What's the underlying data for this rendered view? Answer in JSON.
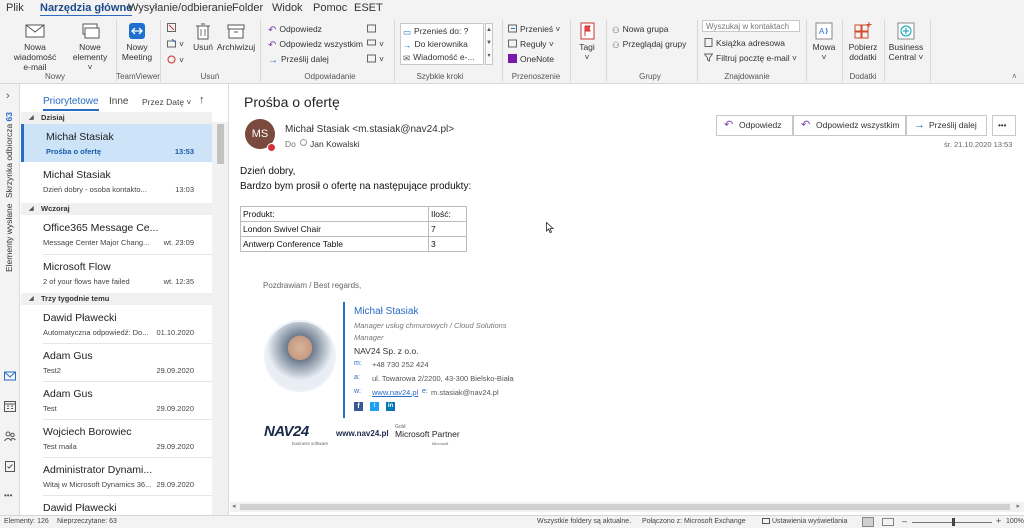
{
  "menu": {
    "tabs": [
      "Plik",
      "Narzędzia główne",
      "Wysyłanie/odbieranie",
      "Folder",
      "Widok",
      "Pomoc",
      "ESET"
    ],
    "active_index": 1
  },
  "ribbon": {
    "new_email": [
      "Nowa wiadomość",
      "e-mail"
    ],
    "new_items": [
      "Nowe",
      "elementy ˅"
    ],
    "group_new": "Nowy",
    "new_meeting": [
      "Nowy",
      "Meeting"
    ],
    "group_teamviewer": "TeamViewer",
    "delete": "Usuń",
    "archive": "Archiwizuj",
    "group_delete": "Usuń",
    "reply": "Odpowiedz",
    "reply_all": "Odpowiedz wszystkim",
    "forward": "Prześlij dalej",
    "group_respond": "Odpowiadanie",
    "qs_items": [
      "Przenieś do: ?",
      "Do kierownika",
      "Wiadomość e-..."
    ],
    "group_quicksteps": "Szybkie kroki",
    "move": "Przenieś ˅",
    "rules": "Reguły ˅",
    "onenote": "OneNote",
    "group_move": "Przenoszenie",
    "tags": [
      "Tagi",
      "˅"
    ],
    "new_group": "Nowa grupa",
    "browse_groups": "Przeglądaj grupy",
    "group_groups": "Grupy",
    "search_placeholder": "Wyszukaj w kontaktach",
    "address_book": "Książka adresowa",
    "filter_email": "Filtruj pocztę e-mail ˅",
    "group_find": "Znajdowanie",
    "speech": [
      "Mowa",
      "˅"
    ],
    "get_addins": [
      "Pobierz",
      "dodatki"
    ],
    "group_addins": "Dodatki",
    "business_central": [
      "Business",
      "Central ˅"
    ]
  },
  "leftnav": {
    "inbox_label": "Skrzynka odbiorcza",
    "inbox_count": "63",
    "sent_label": "Elementy wysłane",
    "expand_glyph": "›",
    "more_glyph": "•••"
  },
  "list": {
    "tab_focused": "Priorytetowe",
    "tab_other": "Inne",
    "sort": "Przez Datę ˅",
    "sort_dir": "↑",
    "groups": [
      "Dzisiaj",
      "Wczoraj",
      "Trzy tygodnie temu"
    ],
    "items": [
      {
        "sender": "Michał Stasiak",
        "subject": "Prośba o ofertę",
        "date": "13:53"
      },
      {
        "sender": "Michał Stasiak",
        "subject": "Dzień dobry - osoba kontakto...",
        "date": "13:03"
      },
      {
        "sender": "Office365 Message Ce...",
        "subject": "Message Center Major Chang...",
        "date": "wt. 23:09"
      },
      {
        "sender": "Microsoft Flow",
        "subject": "2 of your flows have failed",
        "date": "wt. 12:35"
      },
      {
        "sender": "Dawid Pławecki",
        "subject": "Automatyczna odpowiedź: Do...",
        "date": "01.10.2020"
      },
      {
        "sender": "Adam Gus",
        "subject": "Test2",
        "date": "29.09.2020"
      },
      {
        "sender": "Adam Gus",
        "subject": "Test",
        "date": "29.09.2020"
      },
      {
        "sender": "Wojciech Borowiec",
        "subject": "Test maila",
        "date": "29.09.2020"
      },
      {
        "sender": "Administrator Dynami...",
        "subject": "Witaj w Microsoft Dynamics 36...",
        "date": "29.09.2020"
      },
      {
        "sender": "Dawid Pławecki",
        "subject": "",
        "date": ""
      }
    ]
  },
  "mail": {
    "subject": "Prośba o ofertę",
    "initials": "MS",
    "from": "Michał Stasiak <m.stasiak@nav24.pl>",
    "to_label": "Do",
    "to": "Jan Kowalski",
    "btn_reply": "Odpowiedz",
    "btn_reply_all": "Odpowiedz wszystkim",
    "btn_forward": "Prześlij dalej",
    "btn_more": "•••",
    "date": "śr. 21.10.2020 13:53",
    "greeting": "Dzień dobry,",
    "body": "Bardzo bym prosił o ofertę na następujące produkty:",
    "table": [
      [
        "Produkt:",
        "Ilość:"
      ],
      [
        "London Swivel Chair",
        "7"
      ],
      [
        "Antwerp Conference Table",
        "3"
      ]
    ],
    "regards": "Pozdrawiam / Best regards,",
    "sig_name": "Michał Stasiak",
    "sig_title": "Manager usług chmurowych / Cloud Solutions",
    "sig_title2": "Manager",
    "sig_company": "NAV24 Sp. z o.o.",
    "sig_m_label": "m:",
    "sig_m": "+48 730 252 424",
    "sig_a_label": "a:",
    "sig_a": "ul. Towarowa 2/2200, 43-300 Bielsko-Biała",
    "sig_w_label": "w:",
    "sig_w": "www.nav24.pl",
    "sig_e_label": "e:",
    "sig_e": "m.stasiak@nav24.pl",
    "logo_text": "NAV24",
    "logo_sub": "business software",
    "website": "www.nav24.pl",
    "partner_gold": "Gold",
    "partner": "Microsoft Partner",
    "partner_sub": "Microsoft"
  },
  "status": {
    "items": "Elementy: 126",
    "unread": "Nieprzeczytane: 63",
    "folders": "Wszystkie foldery są aktualne.",
    "connected": "Połączono z: Microsoft Exchange",
    "display": "Ustawienia wyświetlania",
    "zoom": "100%"
  },
  "colors": {
    "accent": "#2a6bc4",
    "selected_bg": "#cde3f7",
    "avatar": "#7a4a3e",
    "ribbon_bg": "#f3f3f3"
  }
}
